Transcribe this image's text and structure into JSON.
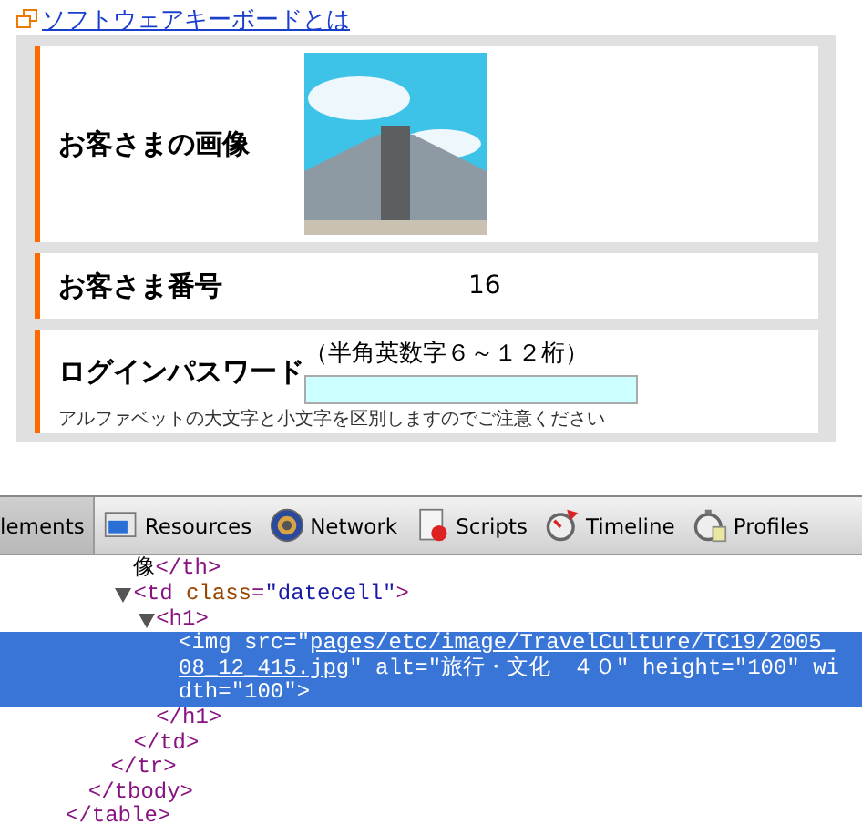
{
  "link": {
    "text": "ソフトウェアキーボードとは"
  },
  "rows": [
    {
      "kind": "image",
      "label": "お客さまの画像"
    },
    {
      "kind": "text",
      "label": "お客さま番号",
      "value": "16"
    },
    {
      "kind": "password",
      "label": "ログインパスワード",
      "hint": "（半角英数字６～１２桁）",
      "note": "アルファベットの大文字と小文字を区別しますのでご注意ください"
    }
  ],
  "devtools": {
    "tabs": [
      {
        "kind": "elements",
        "label": "lements",
        "selected": true
      },
      {
        "kind": "resources",
        "label": "Resources",
        "selected": false
      },
      {
        "kind": "network",
        "label": "Network",
        "selected": false
      },
      {
        "kind": "scripts",
        "label": "Scripts",
        "selected": false
      },
      {
        "kind": "timeline",
        "label": "Timeline",
        "selected": false
      },
      {
        "kind": "profiles",
        "label": "Profiles",
        "selected": false
      }
    ],
    "tree": [
      {
        "close": [
          {
            "kind": "tag",
            "text": "</table>"
          }
        ],
        "children": [
          {
            "close": [
              {
                "kind": "tag",
                "text": "</tbody>"
              }
            ],
            "children": [
              {
                "close": [
                  {
                    "kind": "tag",
                    "text": "</tr>"
                  }
                ],
                "children": [
                  {
                    "open": [
                      {
                        "kind": "text",
                        "text": "像"
                      },
                      {
                        "kind": "tag",
                        "text": "</th>"
                      }
                    ]
                  },
                  {
                    "expanded": true,
                    "open": [
                      {
                        "kind": "tag",
                        "text": "<td"
                      },
                      {
                        "kind": "attr",
                        "text": " class"
                      },
                      {
                        "kind": "tag",
                        "text": "="
                      },
                      {
                        "kind": "value",
                        "text": "\"datecell\""
                      },
                      {
                        "kind": "tag",
                        "text": ">"
                      }
                    ],
                    "close": [
                      {
                        "kind": "tag",
                        "text": "</td>"
                      }
                    ],
                    "children": [
                      {
                        "expanded": true,
                        "open": [
                          {
                            "kind": "tag",
                            "text": "<h1>"
                          }
                        ],
                        "close": [
                          {
                            "kind": "tag",
                            "text": "</h1>"
                          }
                        ],
                        "children": [
                          {
                            "selected": true,
                            "open": [
                              {
                                "kind": "tag",
                                "text": "<img"
                              },
                              {
                                "kind": "attr",
                                "text": " src"
                              },
                              {
                                "kind": "tag",
                                "text": "="
                              },
                              {
                                "kind": "value",
                                "text": "\""
                              },
                              {
                                "kind": "link",
                                "text": "pages/etc/image/TravelCulture/TC19/2005_08_12_415.jpg"
                              },
                              {
                                "kind": "value",
                                "text": "\""
                              },
                              {
                                "kind": "attr",
                                "text": " alt"
                              },
                              {
                                "kind": "tag",
                                "text": "="
                              },
                              {
                                "kind": "value",
                                "text": "\"旅行・文化　４０\""
                              },
                              {
                                "kind": "attr",
                                "text": " height"
                              },
                              {
                                "kind": "tag",
                                "text": "="
                              },
                              {
                                "kind": "value",
                                "text": "\"100\""
                              },
                              {
                                "kind": "attr",
                                "text": " width"
                              },
                              {
                                "kind": "tag",
                                "text": "="
                              },
                              {
                                "kind": "value",
                                "text": "\"100\""
                              },
                              {
                                "kind": "tag",
                                "text": ">"
                              }
                            ]
                          }
                        ]
                      }
                    ]
                  }
                ]
              }
            ]
          }
        ]
      }
    ]
  }
}
